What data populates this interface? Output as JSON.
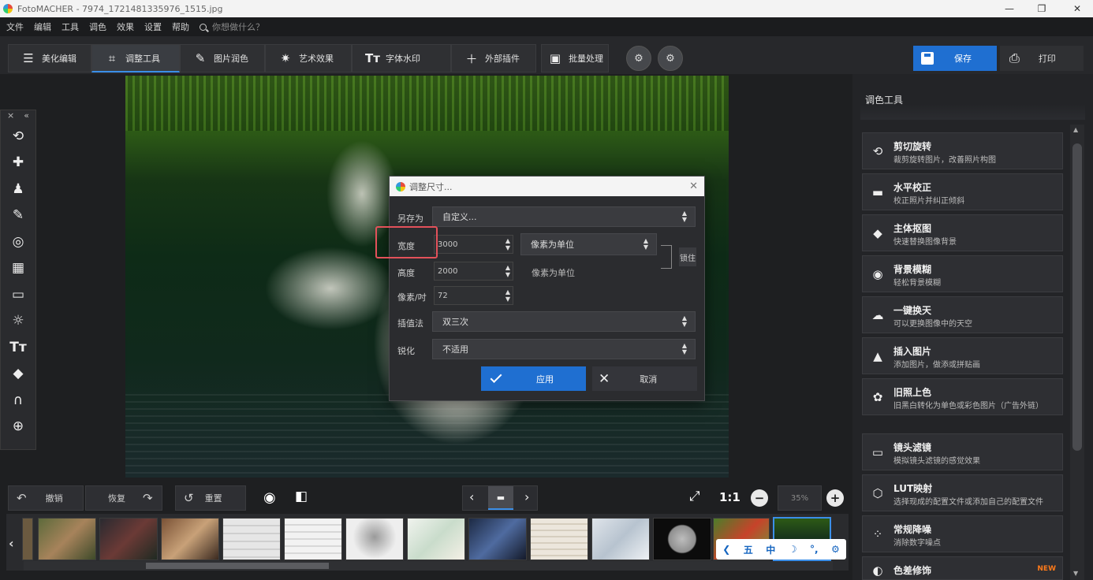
{
  "window": {
    "title": "FotoMACHER - 7974_1721481335976_1515.jpg",
    "minimize": "—",
    "maximize": "❐",
    "close": "✕"
  },
  "menu": {
    "items": [
      "文件",
      "编辑",
      "工具",
      "调色",
      "效果",
      "设置",
      "帮助"
    ],
    "search_placeholder": "你想做什么？"
  },
  "tabs": [
    {
      "label": "美化编辑",
      "icon": "sliders-icon"
    },
    {
      "label": "调整工具",
      "icon": "crop-icon"
    },
    {
      "label": "图片润色",
      "icon": "brush-icon"
    },
    {
      "label": "艺术效果",
      "icon": "magic-wand-icon"
    },
    {
      "label": "字体水印",
      "icon": "text-icon"
    },
    {
      "label": "外部插件",
      "icon": "plus-icon"
    },
    {
      "label": "批量处理",
      "icon": "image-batch-icon"
    }
  ],
  "save_label": "保存",
  "print_label": "打印",
  "left_tools": [
    "crop-rotate-icon",
    "healing-icon",
    "stamp-icon",
    "brush-icon",
    "target-icon",
    "gradient-icon",
    "vignette-icon",
    "brightness-icon",
    "text-icon",
    "fill-icon",
    "magnet-icon",
    "globe-icon"
  ],
  "dialog": {
    "title": "调整尺寸...",
    "preset_label": "另存为",
    "preset_value": "自定义...",
    "width_label": "宽度",
    "width_value": "3000",
    "width_unit": "像素为单位",
    "height_label": "高度",
    "height_value": "2000",
    "height_unit": "像素为单位",
    "resolution_label": "像素/吋",
    "resolution_value": "72",
    "interp_label": "插值法",
    "interp_value": "双三次",
    "sharpen_label": "锐化",
    "sharpen_value": "不适用",
    "lock_label": "锁住",
    "apply_label": "应用",
    "cancel_label": "取消"
  },
  "right_panel": {
    "title": "调色工具",
    "cards": [
      {
        "title": "剪切旋转",
        "desc": "裁剪旋转图片，改善照片构图",
        "icon": "crop-rotate-icon",
        "badge": ""
      },
      {
        "title": "水平校正",
        "desc": "校正照片并纠正倾斜",
        "icon": "landscape-icon",
        "badge": ""
      },
      {
        "title": "主体抠图",
        "desc": "快速替换图像背景",
        "icon": "fill-bucket-icon",
        "badge": ""
      },
      {
        "title": "背景模糊",
        "desc": "轻松背景模糊",
        "icon": "focus-icon",
        "badge": ""
      },
      {
        "title": "一键换天",
        "desc": "可以更换图像中的天空",
        "icon": "cloud-icon",
        "badge": ""
      },
      {
        "title": "插入图片",
        "desc": "添加图片，做添或拼贴画",
        "icon": "insert-image-icon",
        "badge": ""
      },
      {
        "title": "旧照上色",
        "desc": "旧黑白转化为单色或彩色图片（广告外链）",
        "icon": "palette-icon",
        "badge": ""
      },
      {
        "title": "镜头滤镜",
        "desc": "模拟镜头滤镜的感觉效果",
        "icon": "lens-icon",
        "badge": ""
      },
      {
        "title": "LUT映射",
        "desc": "选择现成的配置文件或添加自己的配置文件",
        "icon": "cube-icon",
        "badge": ""
      },
      {
        "title": "常规降噪",
        "desc": "消除数字噪点",
        "icon": "noise-icon",
        "badge": ""
      },
      {
        "title": "色差修饰",
        "desc": "",
        "icon": "chromatic-icon",
        "badge": "NEW"
      }
    ]
  },
  "actions": {
    "undo_label": "撤销",
    "redo_label": "恢复",
    "reset_label": "重置",
    "ratio_label": "1:1",
    "zoom_value": "35%"
  },
  "ime": {
    "items": [
      "五",
      "中",
      "☽",
      "°,",
      "⚙"
    ]
  }
}
